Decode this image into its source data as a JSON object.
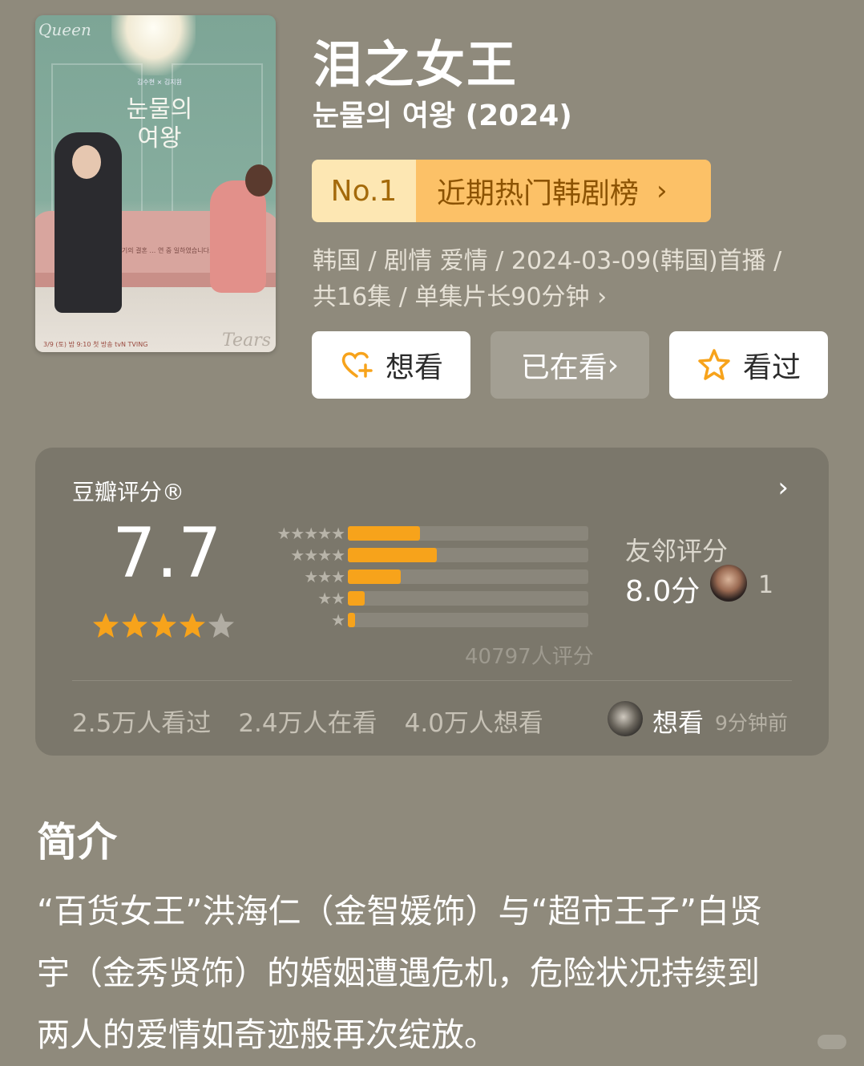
{
  "poster": {
    "title_korean": "눈물의 여왕",
    "queen_script": "Queen",
    "tears_script": "Tears",
    "credit": "김수현 × 김지원",
    "tagline": "세기의 결혼 … 연 중 일하였습니다.",
    "footer": "3/9 (토) 밤 9:10 첫 방송 tvN TVING"
  },
  "header": {
    "title": "泪之女王",
    "subtitle": "눈물의 여왕 (2024)"
  },
  "rank_badge": {
    "number": "No.1",
    "label": "近期热门韩剧榜",
    "chevron": "›"
  },
  "meta": {
    "line1": "韩国 / 剧情 爱情 / 2024-03-09(韩国)首播 /",
    "line2": "共16集 / 单集片长90分钟 ›"
  },
  "actions": {
    "want": "想看",
    "watching": "已在看",
    "watching_chevron": "›",
    "watched": "看过",
    "icons": {
      "want": "heart-plus-icon",
      "watched": "star-outline-icon"
    }
  },
  "rating": {
    "title": "豆瓣评分®",
    "arrow": "›",
    "score": "7.7",
    "stars_filled": 4,
    "stars_total": 5,
    "distribution": [
      {
        "stars": "★★★★★",
        "percent": 30
      },
      {
        "stars": "★★★★",
        "percent": 37
      },
      {
        "stars": "★★★",
        "percent": 22
      },
      {
        "stars": "★★",
        "percent": 7
      },
      {
        "stars": "★",
        "percent": 3
      }
    ],
    "count": "40797人评分",
    "friend_label": "友邻评分",
    "friend_score": "8.0分",
    "friend_count": "1",
    "stats": [
      "2.5万人看过",
      "2.4万人在看",
      "4.0万人想看"
    ],
    "activity_action": "想看",
    "activity_time": "9分钟前",
    "colors": {
      "bar": "#f7a31b",
      "star": "#f7a31b",
      "star_empty": "#b1ada3"
    }
  },
  "intro": {
    "heading": "简介",
    "line1": "“百货女王”洪海仁（金智媛饰）与“超市王子”白贤",
    "line2": "宇（金秀贤饰）的婚姻遭遇危机，危险状况持续到",
    "line3": "两人的爱情如奇迹般再次绽放。"
  }
}
